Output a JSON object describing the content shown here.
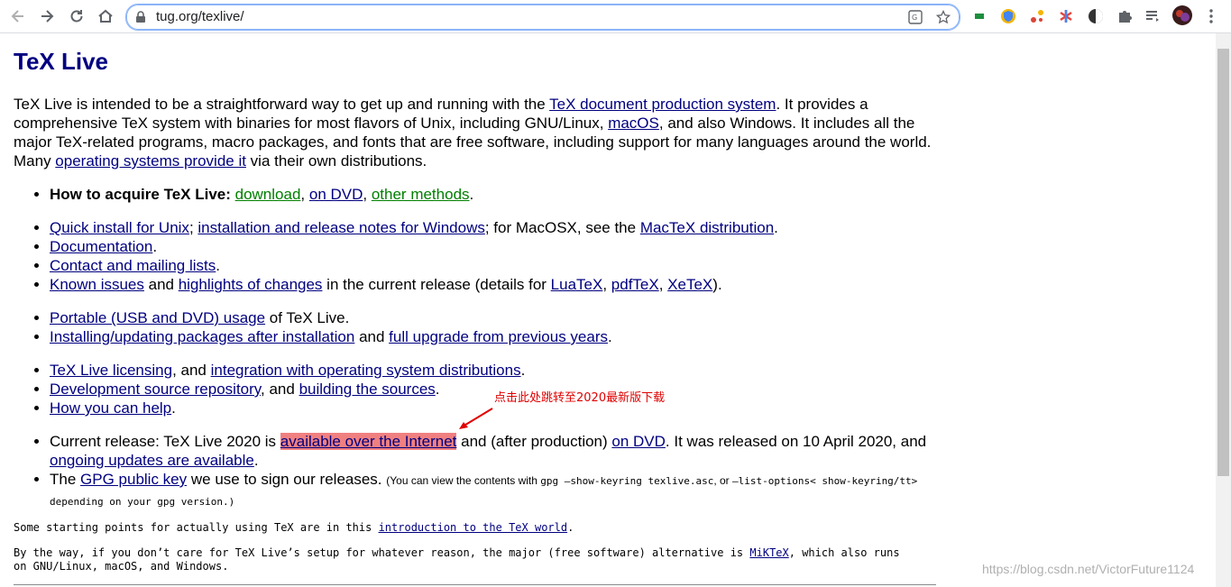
{
  "browser": {
    "url": "tug.org/texlive/"
  },
  "page": {
    "title": "TeX Live",
    "intro": {
      "t1": "TeX Live is intended to be a straightforward way to get up and running with the ",
      "link_tds": "TeX document production system",
      "t2": ". It provides a comprehensive TeX system with binaries for most flavors of Unix, including GNU/Linux, ",
      "link_macos": "macOS",
      "t3": ", and also Windows. It includes all the major TeX-related programs, macro packages, and fonts that are free software, including support for many languages around the world. Many ",
      "link_os": "operating systems provide it",
      "t4": " via their own distributions."
    },
    "acquire": {
      "label": "How to acquire TeX Live:",
      "download": "download",
      "sep1": ", ",
      "on_dvd": "on DVD",
      "sep2": ", ",
      "other": "other methods",
      "end": "."
    },
    "list2": {
      "quick_install": "Quick install for Unix",
      "sep1": "; ",
      "windows_notes": "installation and release notes for Windows",
      "t1": "; for MacOSX, see the ",
      "mactex": "MacTeX distribution",
      "end1": ".",
      "documentation": "Documentation",
      "end2": ".",
      "contact": "Contact and mailing lists",
      "end3": ".",
      "known_issues": "Known issues",
      "t2": " and ",
      "highlights": "highlights of changes",
      "t3": " in the current release (details for ",
      "luatex": "LuaTeX",
      "c1": ", ",
      "pdftex": "pdfTeX",
      "c2": ", ",
      "xetex": "XeTeX",
      "end4": ")."
    },
    "list3": {
      "portable": "Portable (USB and DVD) usage",
      "t1": " of TeX Live.",
      "installing": "Installing/updating packages after installation",
      "t2": " and ",
      "full_upgrade": "full upgrade from previous years",
      "end": "."
    },
    "list4": {
      "licensing": "TeX Live licensing",
      "t1": ", and ",
      "integration": "integration with operating system distributions",
      "end1": ".",
      "dev_repo": "Development source repository",
      "t2": ", and ",
      "building": "building the sources",
      "end2": ".",
      "help": "How you can help",
      "end3": "."
    },
    "list5": {
      "t1": "Current release: TeX Live 2020 is ",
      "available": "available over the Internet",
      "t2": " and (after production) ",
      "on_dvd": "on DVD",
      "t3": ". It was released on 10 April 2020, and ",
      "ongoing": "ongoing updates are available",
      "end1": ".",
      "t4": "The ",
      "gpg": "GPG public key",
      "t5": " we use to sign our releases. ",
      "s1": "(You can view the contents with ",
      "m1": "gpg  —show-keyring  texlive.asc",
      "s2": ", or ",
      "m2": "—list-options<  show-keyring/tt> depending on your gpg version.)"
    },
    "starting": {
      "t1": "Some starting points for actually using TeX are in this ",
      "link": "introduction to the TeX world",
      "end": "."
    },
    "byway": {
      "t1": "By the way, if you don’t care for TeX Live’s setup for whatever reason, the major (free software) alternative is ",
      "link": "MiKTeX",
      "t2": ", which also runs on GNU/Linux, macOS, and Windows."
    }
  },
  "annotation": "点击此处跳转至2020最新版下载",
  "watermark": "https://blog.csdn.net/VictorFuture1124",
  "colors": {
    "link": "#000080",
    "green_link": "#008000",
    "highlight": "#f08080",
    "annotation": "#e00000"
  }
}
